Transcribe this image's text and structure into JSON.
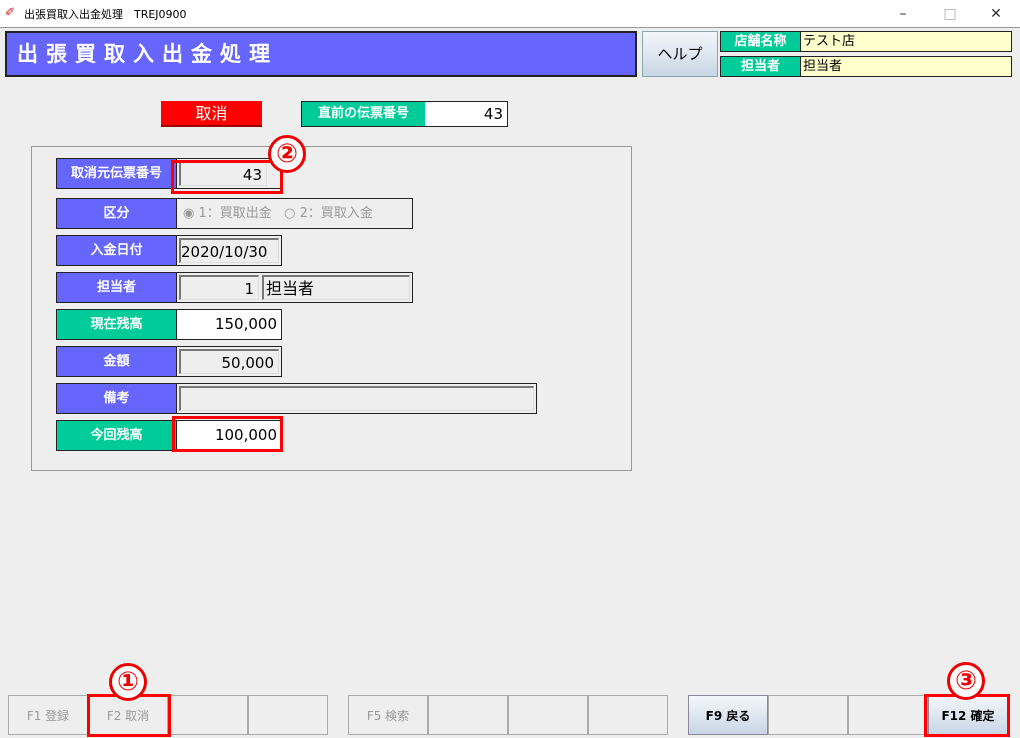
{
  "window": {
    "title": "出張買取入出金処理　TREJ0900",
    "minimize": "–",
    "maximize": "□",
    "close": "✕"
  },
  "header": {
    "title": "出張買取入出金処理",
    "help": "ヘルプ",
    "store_label": "店舗名称",
    "store_value": "テスト店",
    "staff_label": "担当者",
    "staff_value": "担当者"
  },
  "mode": "取消",
  "prev_slip": {
    "label": "直前の伝票番号",
    "value": "43"
  },
  "form": {
    "orig_slip": {
      "label": "取消元伝票番号",
      "value": "43"
    },
    "kubun": {
      "label": "区分",
      "opt1": "1：買取出金",
      "opt2": "2：買取入金",
      "selected": 1
    },
    "date": {
      "label": "入金日付",
      "value": "2020/10/30"
    },
    "staff": {
      "label": "担当者",
      "code": "1",
      "name": "担当者"
    },
    "cur_balance": {
      "label": "現在残高",
      "value": "150,000"
    },
    "amount": {
      "label": "金額",
      "value": "50,000"
    },
    "note": {
      "label": "備考",
      "value": ""
    },
    "new_balance": {
      "label": "今回残高",
      "value": "100,000"
    }
  },
  "annotations": {
    "c1": "①",
    "c2": "②",
    "c3": "③"
  },
  "fkeys": [
    "F1 登録",
    "F2 取消",
    "",
    "",
    "F5 検索",
    "",
    "",
    "",
    "F9 戻る",
    "",
    "",
    "F12 確定"
  ]
}
